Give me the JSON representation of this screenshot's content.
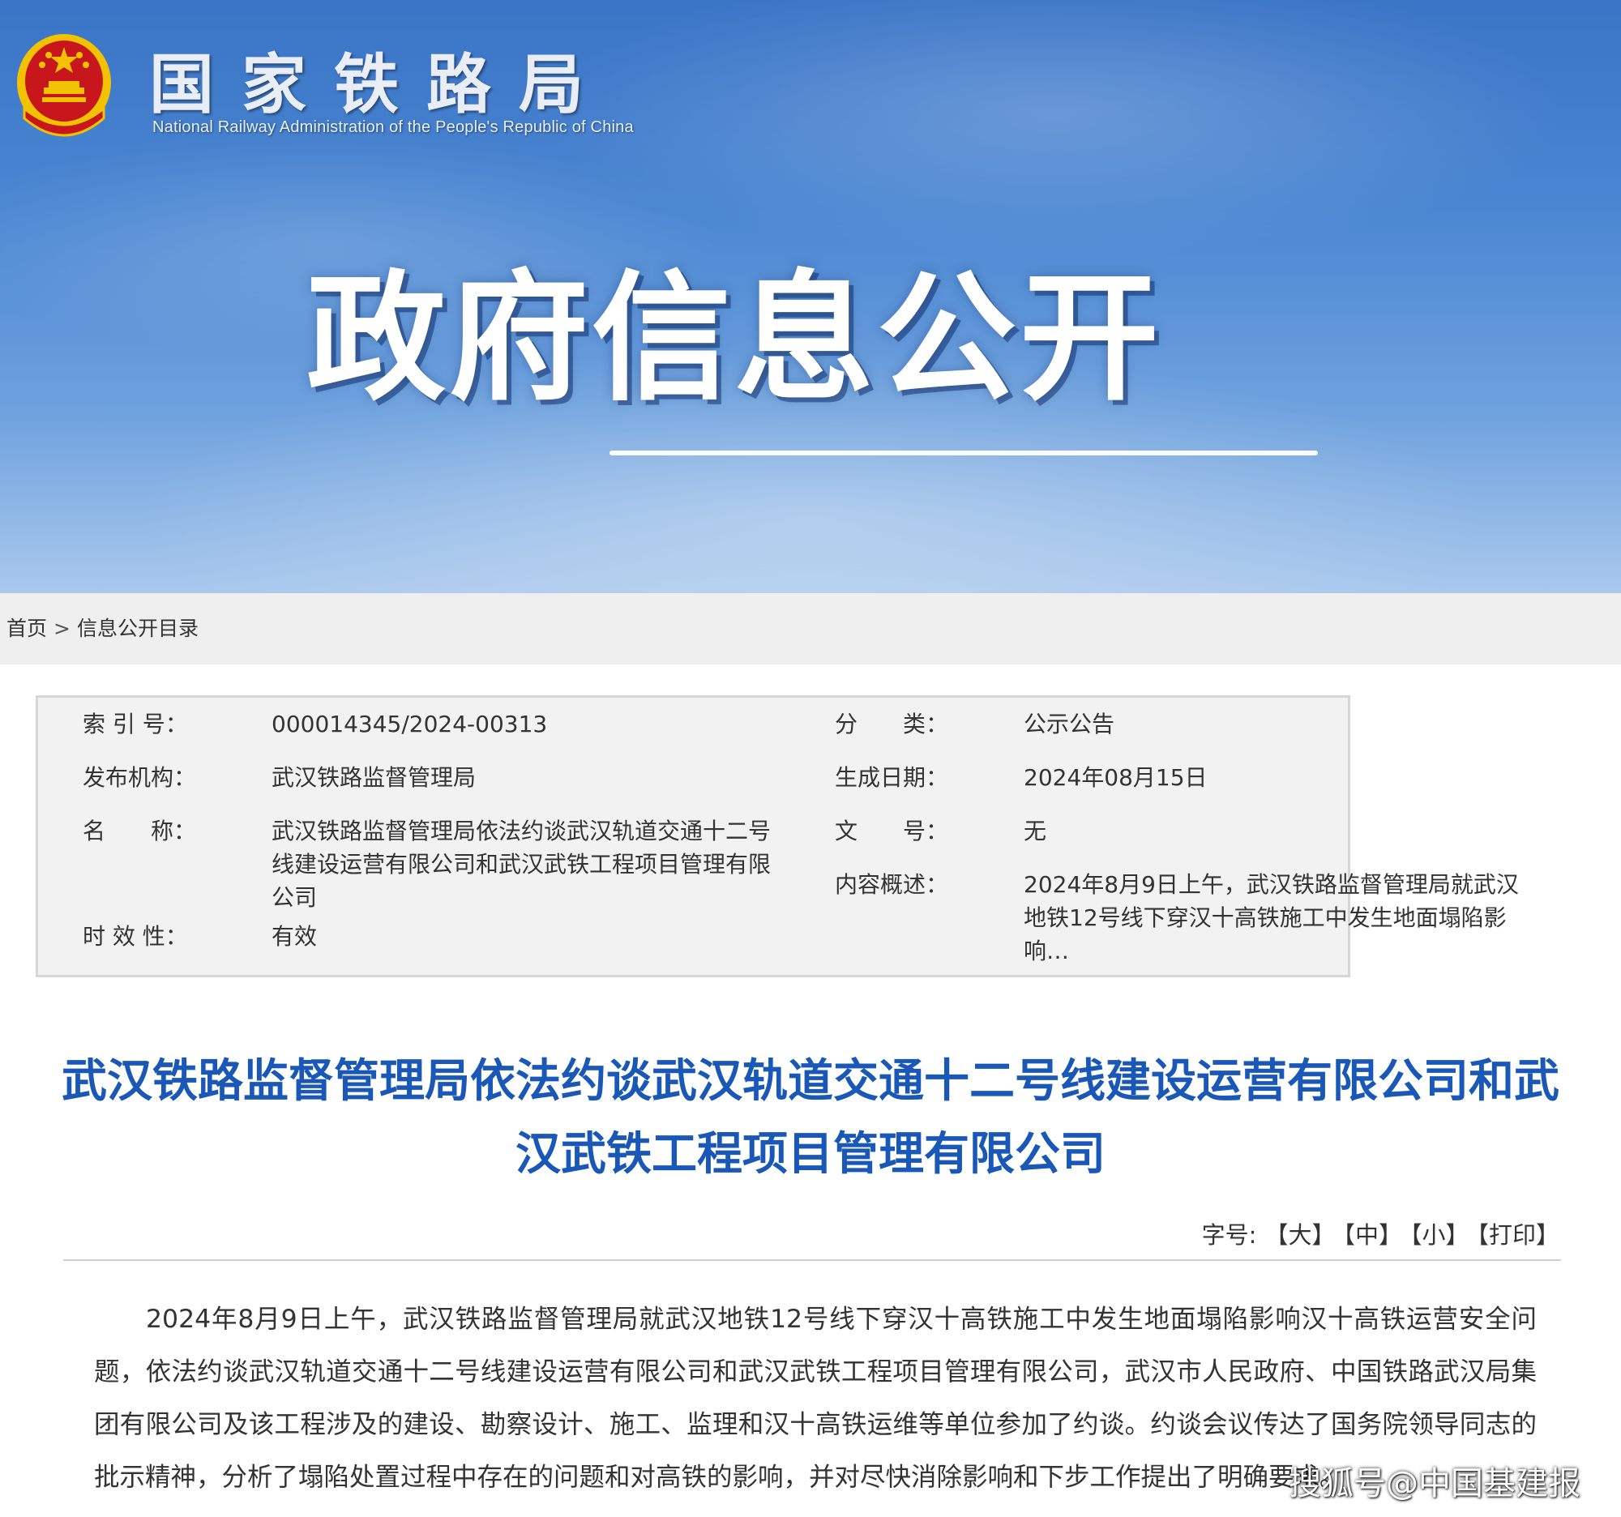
{
  "header": {
    "site_name": "国家铁路局",
    "site_name_en": "National Railway Administration of the People's Republic of China",
    "banner_title": "政府信息公开"
  },
  "breadcrumb": {
    "home": "首页",
    "separator": ">",
    "current": "信息公开目录"
  },
  "meta": {
    "index_label": "索 引 号：",
    "index_value": "000014345/2024-00313",
    "category_label": "分　　类：",
    "category_value": "公示公告",
    "publisher_label": "发布机构：",
    "publisher_value": "武汉铁路监督管理局",
    "date_label": "生成日期：",
    "date_value": "2024年08月15日",
    "name_label": "名　　称：",
    "name_value": "武汉铁路监督管理局依法约谈武汉轨道交通十二号线建设运营有限公司和武汉武铁工程项目管理有限公司",
    "doc_no_label": "文　　号：",
    "doc_no_value": "无",
    "summary_label": "内容概述：",
    "summary_value": "2024年8月9日上午，武汉铁路监督管理局就武汉地铁12号线下穿汉十高铁施工中发生地面塌陷影响…",
    "validity_label": "时 效 性：",
    "validity_value": "有效"
  },
  "article": {
    "title": "武汉铁路监督管理局依法约谈武汉轨道交通十二号线建设运营有限公司和武汉武铁工程项目管理有限公司",
    "body": "2024年8月9日上午，武汉铁路监督管理局就武汉地铁12号线下穿汉十高铁施工中发生地面塌陷影响汉十高铁运营安全问题，依法约谈武汉轨道交通十二号线建设运营有限公司和武汉武铁工程项目管理有限公司，武汉市人民政府、中国铁路武汉局集团有限公司及该工程涉及的建设、勘察设计、施工、监理和汉十高铁运维等单位参加了约谈。约谈会议传达了国务院领导同志的批示精神，分析了塌陷处置过程中存在的问题和对高铁的影响，并对尽快消除影响和下步工作提出了明确要求。"
  },
  "font_controls": {
    "label": "字号:",
    "large": "【大】",
    "medium": "【中】",
    "small": "【小】",
    "print": "【打印】"
  },
  "watermark": "搜狐号@中国基建报",
  "colors": {
    "title_blue": "#1a58b8",
    "banner_blue": "#4a86d2",
    "emblem_red": "#c8161d",
    "emblem_gold": "#f2c200"
  }
}
